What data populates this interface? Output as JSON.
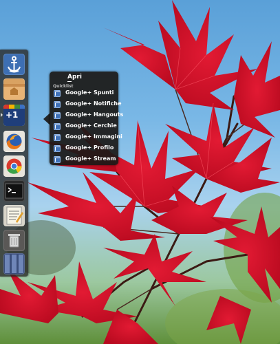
{
  "launcher": {
    "items": [
      {
        "name": "anchor-app-icon"
      },
      {
        "name": "home-folder-icon"
      },
      {
        "name": "google-plus-icon",
        "badge": "+1"
      },
      {
        "name": "firefox-icon"
      },
      {
        "name": "chrome-icon"
      },
      {
        "name": "terminal-icon"
      },
      {
        "name": "text-editor-icon"
      },
      {
        "name": "trash-icon"
      },
      {
        "name": "workspace-switcher-icon"
      }
    ]
  },
  "quicklist": {
    "open_label": "Apri",
    "section_label": "Quicklist",
    "items": [
      {
        "label": "Google+ Spunti"
      },
      {
        "label": "Google+ Notifiche"
      },
      {
        "label": "Google+ Hangouts"
      },
      {
        "label": "Google+ Cerchie"
      },
      {
        "label": "Google+ Immagini"
      },
      {
        "label": "Google+ Profilo"
      },
      {
        "label": "Google+ Stream"
      }
    ]
  },
  "colors": {
    "sky": "#6fb0e2",
    "leaf": "#d3102a",
    "menu_bg": "#1c1a18",
    "gplus_blue": "#3f71b8"
  }
}
